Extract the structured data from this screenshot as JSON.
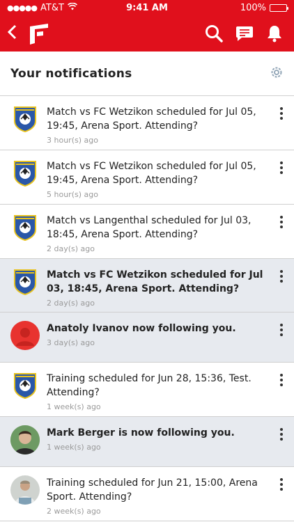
{
  "status_bar": {
    "carrier": "AT&T",
    "time": "9:41 AM",
    "battery": "100%"
  },
  "app_bar": {
    "icons": [
      "back-icon",
      "app-logo",
      "search-icon",
      "chat-icon",
      "bell-icon"
    ]
  },
  "header": {
    "title": "Your notifications",
    "settings_icon": "gear-icon"
  },
  "colors": {
    "brand": "#e0101c",
    "unread_bg": "#e7eaef"
  },
  "notifications": [
    {
      "type": "crest",
      "unread": false,
      "text": "Match vs FC Wetzikon  scheduled for Jul 05, 19:45, Arena Sport. Attending?",
      "time": "3 hour(s) ago"
    },
    {
      "type": "crest",
      "unread": false,
      "text": "Match vs FC Wetzikon  scheduled for Jul 05, 19:45, Arena Sport. Attending?",
      "time": "5 hour(s) ago"
    },
    {
      "type": "crest",
      "unread": false,
      "text": "Match vs  Langenthal  scheduled for Jul 03, 18:45, Arena Sport. Attending?",
      "time": "2 day(s) ago"
    },
    {
      "type": "crest",
      "unread": true,
      "text": "Match vs FC Wetzikon scheduled for Jul 03, 18:45, Arena Sport. Attending?",
      "time": "2 day(s) ago"
    },
    {
      "type": "default-avatar",
      "unread": true,
      "text": "Anatoly Ivanov  now following you.",
      "time": "3 day(s) ago"
    },
    {
      "type": "crest",
      "unread": false,
      "text": "Training scheduled for Jun 28, 15:36, Test. Attending?",
      "time": "1 week(s) ago"
    },
    {
      "type": "photo",
      "unread": true,
      "text": "Mark Berger  is now following you.",
      "time": "1 week(s) ago"
    },
    {
      "type": "photo2",
      "unread": false,
      "text": "Training scheduled for Jun 21, 15:00, Arena Sport. Attending?",
      "time": "2 week(s) ago"
    }
  ]
}
